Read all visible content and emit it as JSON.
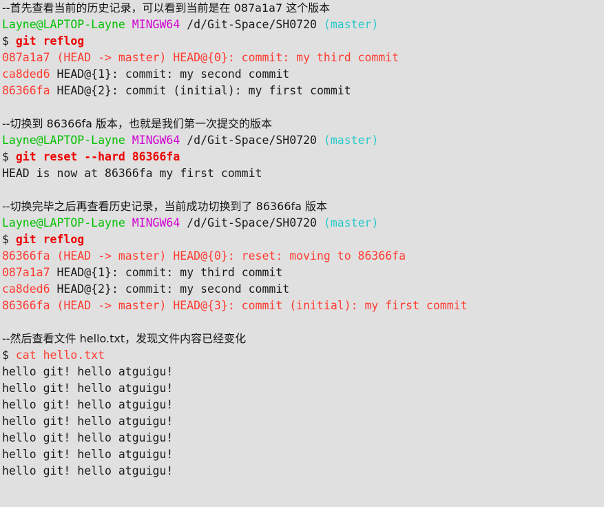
{
  "terminal": {
    "app": "Git Bash (MINGW64)",
    "background_color": "#e0e0e0",
    "colors": {
      "default_text": "#1a1a1a",
      "user_host_green": "#00c000",
      "mingw_magenta": "#d000d0",
      "branch_cyan": "#2bc9c9",
      "output_red": "#ff3b30",
      "command_red_bold": "#ee0000"
    },
    "prompt": {
      "user_host": "Layne@LAPTOP-Layne",
      "shell": "MINGW64",
      "path": "/d/Git-Space/SH0720",
      "branch": "(master)",
      "symbol": "$"
    },
    "lines": [
      {
        "id": "comment-1",
        "type": "comment",
        "text": "--首先查看当前的历史记录，可以看到当前是在 087a1a7 这个版本"
      },
      {
        "id": "prompt-1",
        "type": "prompt"
      },
      {
        "id": "command-1",
        "type": "command",
        "symbol": "$",
        "command": "git reflog"
      },
      {
        "id": "output-1",
        "type": "output-red-full",
        "text": "087a1a7 (HEAD -> master) HEAD@{0}: commit: my third commit"
      },
      {
        "id": "output-2",
        "type": "output-hash",
        "hash": "ca8ded6",
        "rest": " HEAD@{1}: commit: my second commit"
      },
      {
        "id": "output-3",
        "type": "output-hash",
        "hash": "86366fa",
        "rest": " HEAD@{2}: commit (initial): my first commit"
      },
      {
        "id": "blank-1",
        "type": "blank"
      },
      {
        "id": "comment-2",
        "type": "comment",
        "text": "--切换到 86366fa 版本，也就是我们第一次提交的版本"
      },
      {
        "id": "prompt-2",
        "type": "prompt"
      },
      {
        "id": "command-2",
        "type": "command",
        "symbol": "$",
        "command": "git reset --hard 86366fa"
      },
      {
        "id": "output-4",
        "type": "output-plain",
        "text": "HEAD is now at 86366fa my first commit"
      },
      {
        "id": "blank-2",
        "type": "blank"
      },
      {
        "id": "comment-3",
        "type": "comment",
        "text": "--切换完毕之后再查看历史记录，当前成功切换到了 86366fa 版本"
      },
      {
        "id": "prompt-3",
        "type": "prompt"
      },
      {
        "id": "command-3",
        "type": "command",
        "symbol": "$",
        "command": "git reflog"
      },
      {
        "id": "output-5",
        "type": "output-red-full",
        "text": "86366fa (HEAD -> master) HEAD@{0}: reset: moving to 86366fa"
      },
      {
        "id": "output-6",
        "type": "output-hash",
        "hash": "087a1a7",
        "rest": " HEAD@{1}: commit: my third commit"
      },
      {
        "id": "output-7",
        "type": "output-hash",
        "hash": "ca8ded6",
        "rest": " HEAD@{2}: commit: my second commit"
      },
      {
        "id": "output-8",
        "type": "output-red-full",
        "text": "86366fa (HEAD -> master) HEAD@{3}: commit (initial): my first commit"
      },
      {
        "id": "blank-3",
        "type": "blank"
      },
      {
        "id": "comment-4",
        "type": "comment",
        "text": "--然后查看文件 hello.txt，发现文件内容已经变化"
      },
      {
        "id": "command-4",
        "type": "command-plain",
        "symbol": "$",
        "command": "cat hello.txt"
      },
      {
        "id": "file-1",
        "type": "output-plain",
        "text": "hello git! hello atguigu!"
      },
      {
        "id": "file-2",
        "type": "output-plain",
        "text": "hello git! hello atguigu!"
      },
      {
        "id": "file-3",
        "type": "output-plain",
        "text": "hello git! hello atguigu!"
      },
      {
        "id": "file-4",
        "type": "output-plain",
        "text": "hello git! hello atguigu!"
      },
      {
        "id": "file-5",
        "type": "output-plain",
        "text": "hello git! hello atguigu!"
      },
      {
        "id": "file-6",
        "type": "output-plain",
        "text": "hello git! hello atguigu!"
      },
      {
        "id": "file-7",
        "type": "output-plain",
        "text": "hello git! hello atguigu!"
      }
    ]
  }
}
